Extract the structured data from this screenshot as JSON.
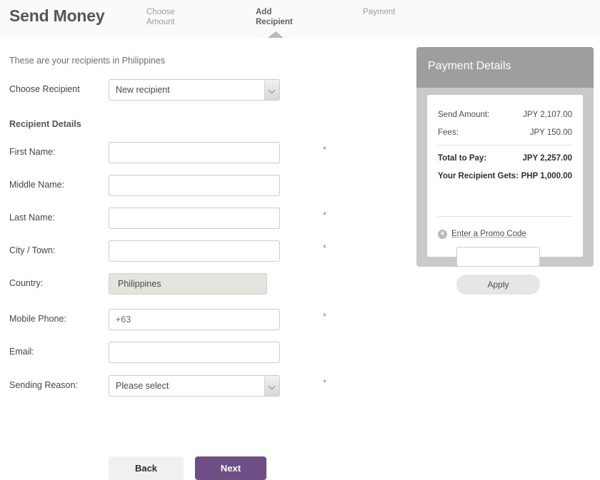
{
  "header": {
    "brand_title": "Send Money",
    "steps": [
      {
        "label": "Choose Amount",
        "line1": "Choose",
        "line2": "Amount",
        "active": false
      },
      {
        "label": "Add Recipient",
        "line1": "Add",
        "line2": "Recipient",
        "active": true
      },
      {
        "label": "Payment",
        "line1": "Payment",
        "line2": "",
        "active": false
      }
    ]
  },
  "form": {
    "intro_text": "These are your recipients in Philippines",
    "choose_recipient_label": "Choose Recipient",
    "choose_recipient_value": "New recipient",
    "section_heading": "Recipient Details",
    "required_marker": "*",
    "fields": [
      {
        "label": "First Name:",
        "value": "",
        "placeholder": "",
        "required": true,
        "type": "text"
      },
      {
        "label": "Middle Name:",
        "value": "",
        "placeholder": "",
        "required": false,
        "type": "text"
      },
      {
        "label": "Last Name:",
        "value": "",
        "placeholder": "",
        "required": true,
        "type": "text"
      },
      {
        "label": "City / Town:",
        "value": "",
        "placeholder": "",
        "required": true,
        "type": "text"
      },
      {
        "label": "Country:",
        "value": "Philippines",
        "placeholder": "",
        "required": false,
        "type": "readonly"
      },
      {
        "label": "Mobile Phone:",
        "value": "",
        "placeholder": "+63",
        "required": true,
        "type": "text"
      },
      {
        "label": "Email:",
        "value": "",
        "placeholder": "",
        "required": false,
        "type": "text"
      },
      {
        "label": "Sending Reason:",
        "value": "Please select",
        "placeholder": "",
        "required": true,
        "type": "select"
      }
    ],
    "back_label": "Back",
    "next_label": "Next"
  },
  "payment_details": {
    "title": "Payment Details",
    "rows": [
      {
        "label": "Send Amount:",
        "value": "JPY 2,107.00",
        "strong": false
      },
      {
        "label": "Fees:",
        "value": "JPY 150.00",
        "strong": false
      },
      {
        "label": "Total to Pay:",
        "value": "JPY 2,257.00",
        "strong": true
      },
      {
        "label": "Your Recipient Gets:",
        "value": "PHP 1,000.00",
        "strong": true
      }
    ],
    "promo_plus": "+",
    "promo_link": "Enter a Promo Code",
    "promo_value": "",
    "promo_placeholder": "",
    "apply_label": "Apply"
  },
  "colors": {
    "accent_purple": "#6f4e86",
    "panel_header_grey": "#9e9e9e",
    "panel_body_grey": "#c9c9c9",
    "readonly_field": "#e4e3de",
    "link_underline": "#8fc3bd"
  }
}
